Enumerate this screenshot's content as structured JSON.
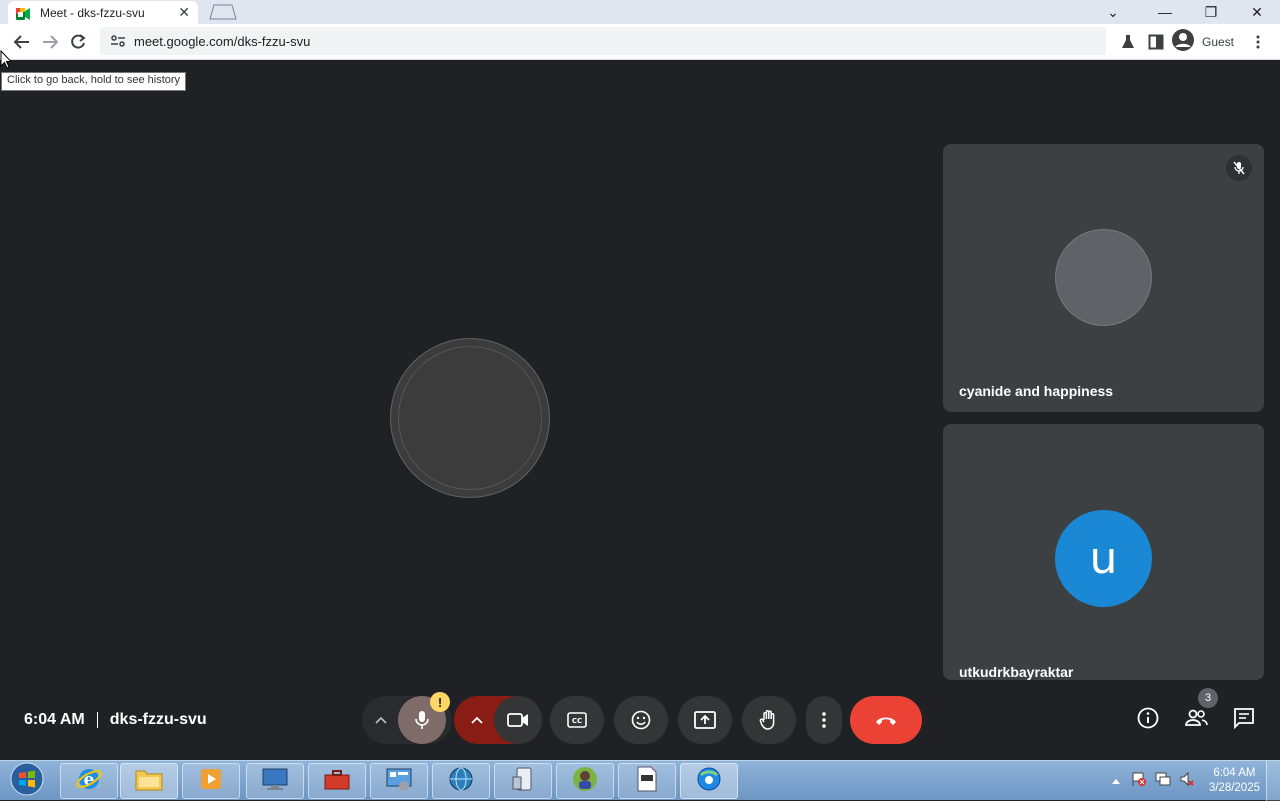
{
  "browser": {
    "tab_title": "Meet - dks-fzzu-svu",
    "url": "meet.google.com/dks-fzzu-svu",
    "profile_label": "Guest",
    "back_tooltip": "Click to go back, hold to see history"
  },
  "meeting": {
    "time": "6:04 AM",
    "code": "dks-fzzu-svu",
    "participant_count": "3",
    "mic_warning": "!"
  },
  "participants": [
    {
      "name": "cyanide and happiness",
      "muted": true
    },
    {
      "name": "utkudrkbayraktar",
      "initial": "u",
      "avatar_color": "#1a88d4"
    }
  ],
  "colors": {
    "end_call": "#ea4335",
    "mic_off": "#7f6b68",
    "camera_off": "#8a1c16",
    "warning": "#fdd663"
  },
  "taskbar": {
    "clock_time": "6:04 AM",
    "clock_date": "3/28/2025"
  }
}
